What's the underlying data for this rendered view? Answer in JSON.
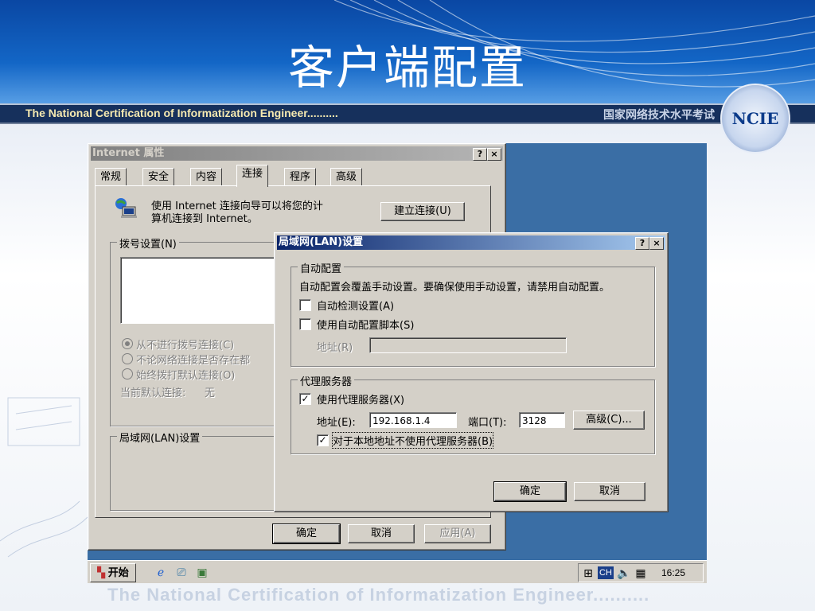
{
  "slide": {
    "title": "客户端配置",
    "banner_left": "The National Certification of Informatization Engineer..........",
    "banner_right": "国家网络技术水平考试",
    "logo_text": "NCIE",
    "footer": "The National Certification of Informatization Engineer.........."
  },
  "internet_props": {
    "title": "Internet 属性",
    "help_btn": "?",
    "close_btn": "×",
    "tabs": [
      "常规",
      "安全",
      "内容",
      "连接",
      "程序",
      "高级"
    ],
    "wizard_text_1": "使用 Internet 连接向导可以将您的计",
    "wizard_text_2": "算机连接到 Internet。",
    "setup_btn": "建立连接(U)",
    "dialup_group": "拨号设置(N)",
    "radio_1": "从不进行拨号连接(C)",
    "radio_2": "不论网络连接是否存在都",
    "radio_3": "始终拨打默认连接(O)",
    "default_conn_label": "当前默认连接:",
    "default_conn_value": "无",
    "lan_group": "局域网(LAN)设置",
    "ok_btn": "确定",
    "cancel_btn": "取消",
    "apply_btn": "应用(A)"
  },
  "lan_dialog": {
    "title": "局域网(LAN)设置",
    "help_btn": "?",
    "close_btn": "×",
    "auto_group": "自动配置",
    "auto_desc": "自动配置会覆盖手动设置。要确保使用手动设置，请禁用自动配置。",
    "auto_detect": "自动检测设置(A)",
    "auto_detect_checked": false,
    "auto_script": "使用自动配置脚本(S)",
    "auto_script_checked": false,
    "address_label": "地址(R)",
    "proxy_group": "代理服务器",
    "use_proxy": "使用代理服务器(X)",
    "use_proxy_checked": true,
    "proxy_address_label": "地址(E):",
    "proxy_address_value": "192.168.1.4",
    "port_label": "端口(T):",
    "port_value": "3128",
    "advanced_btn": "高级(C)...",
    "bypass_local": "对于本地地址不使用代理服务器(B)",
    "bypass_local_checked": true,
    "ok_btn": "确定",
    "cancel_btn": "取消"
  },
  "taskbar": {
    "start": "开始",
    "tray_ime": "CH",
    "clock": "16:25"
  }
}
